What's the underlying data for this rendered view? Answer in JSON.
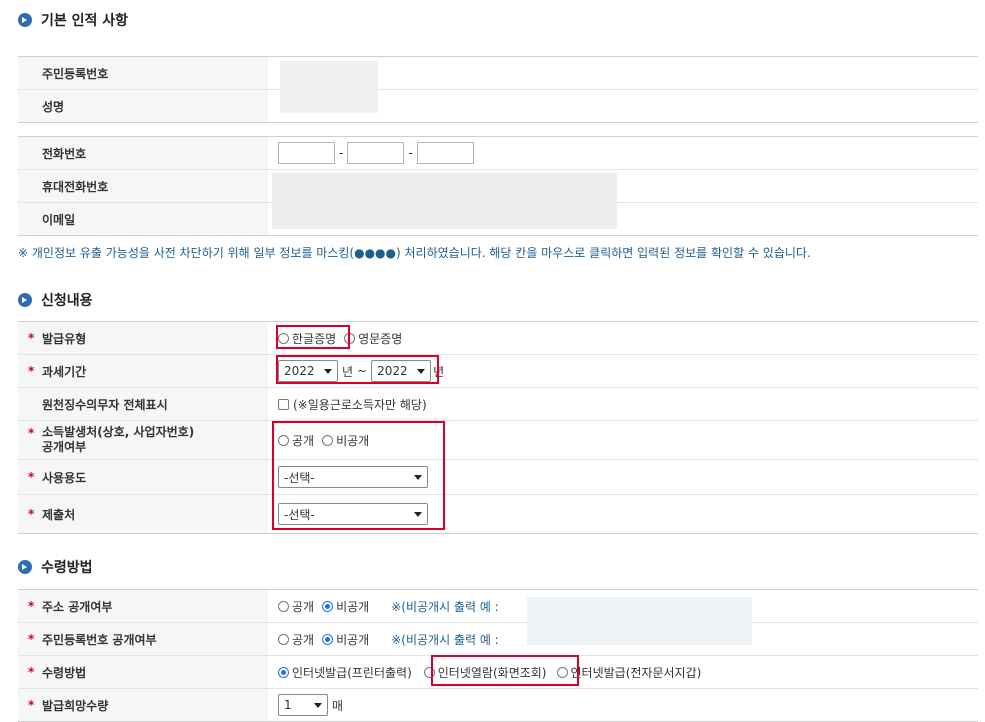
{
  "sections": {
    "basic": "기본 인적 사항",
    "application": "신청내용",
    "receipt": "수령방법"
  },
  "basic": {
    "rrn_label": "주민등록번호",
    "name_label": "성명",
    "phone_label": "전화번호",
    "mobile_label": "휴대전화번호",
    "email_label": "이메일",
    "dash": "-",
    "notice": "※ 개인정보 유출 가능성을 사전 차단하기 위해 일부 정보를 마스킹(●●●●) 처리하였습니다. 해당 칸을 마우스로 클릭하면 입력된 정보를 확인할 수 있습니다."
  },
  "application": {
    "req_mark": "*",
    "type_label": "발급유형",
    "type_options": [
      "한글증명",
      "영문증명"
    ],
    "period_label": "과세기간",
    "period_from": "2022",
    "period_to": "2022",
    "year_unit": "년",
    "tilde": "~",
    "withholding_label": "원천징수의무자 전체표시",
    "withholding_text": "(※일용근로소득자만 해당)",
    "income_label_1": "소득발생처(상호, 사업자번호)",
    "income_label_2": "공개여부",
    "income_options": [
      "공개",
      "비공개"
    ],
    "usage_label": "사용용도",
    "usage_value": "-선택-",
    "submit_label": "제출처",
    "submit_value": "-선택-"
  },
  "receipt": {
    "addr_label": "주소 공개여부",
    "addr_options": [
      "공개",
      "비공개"
    ],
    "addr_note": "※(비공개시 출력 예 :",
    "rrn_label": "주민등록번호 공개여부",
    "rrn_options": [
      "공개",
      "비공개"
    ],
    "rrn_note": "※(비공개시 출력 예 :",
    "method_label": "수령방법",
    "method_options": [
      "인터넷발급(프린터출력)",
      "인터넷열람(화면조회)",
      "인터넷발급(전자문서지갑)"
    ],
    "qty_label": "발급희망수량",
    "qty_value": "1",
    "qty_unit": "매"
  },
  "colors": {
    "accent": "#2d6db5",
    "required": "#d0021b",
    "highlight": "#d6002a",
    "note": "#1d5f8f"
  }
}
